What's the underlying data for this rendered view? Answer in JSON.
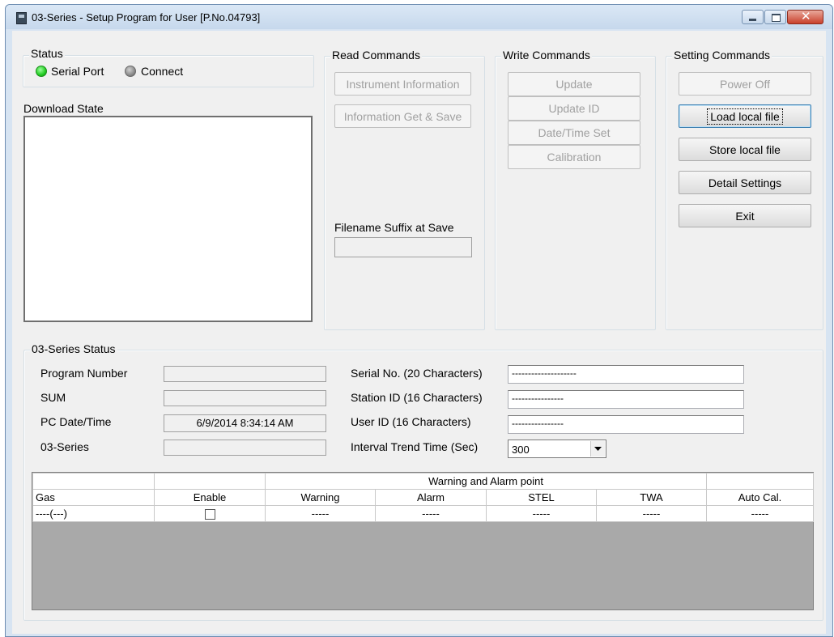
{
  "window": {
    "title": "03-Series - Setup Program for User [P.No.04793]",
    "controls": [
      "minimize",
      "maximize",
      "close"
    ]
  },
  "status": {
    "group_title": "Status",
    "serial_port_label": "Serial Port",
    "serial_port_state_color": "#22cc22",
    "connect_label": "Connect",
    "connect_state_color": "#8c8c8c"
  },
  "download_state": {
    "label": "Download State",
    "content": ""
  },
  "read_commands": {
    "group_title": "Read Commands",
    "instrument_information": "Instrument Information",
    "information_get_save": "Information Get & Save",
    "filename_suffix_label": "Filename Suffix at Save",
    "filename_suffix_value": ""
  },
  "write_commands": {
    "group_title": "Write Commands",
    "update": "Update",
    "update_id": "Update ID",
    "datetime_set": "Date/Time Set",
    "calibration": "Calibration"
  },
  "setting_commands": {
    "group_title": "Setting Commands",
    "power_off": "Power Off",
    "load_local_file": "Load local file",
    "store_local_file": "Store local file",
    "detail_settings": "Detail Settings",
    "exit": "Exit"
  },
  "series_status": {
    "group_title": "03-Series Status",
    "program_number_label": "Program Number",
    "program_number_value": "",
    "sum_label": "SUM",
    "sum_value": "",
    "pc_datetime_label": "PC Date/Time",
    "pc_datetime_value": "6/9/2014 8:34:14 AM",
    "series_label": "03-Series",
    "series_value": "",
    "serial_no_label": "Serial No. (20 Characters)",
    "serial_no_value": "--------------------",
    "station_id_label": "Station ID (16 Characters)",
    "station_id_value": "----------------",
    "user_id_label": "User ID (16 Characters)",
    "user_id_value": "----------------",
    "interval_label": "Interval Trend Time (Sec)",
    "interval_value": "300"
  },
  "gas_table": {
    "group_header": "Warning and Alarm point",
    "columns": [
      "Gas",
      "Enable",
      "Warning",
      "Alarm",
      "STEL",
      "TWA",
      "Auto Cal."
    ],
    "rows": [
      {
        "gas": "----(---)",
        "enable": false,
        "warning": "-----",
        "alarm": "-----",
        "stel": "-----",
        "twa": "-----",
        "auto_cal": "-----"
      }
    ]
  }
}
